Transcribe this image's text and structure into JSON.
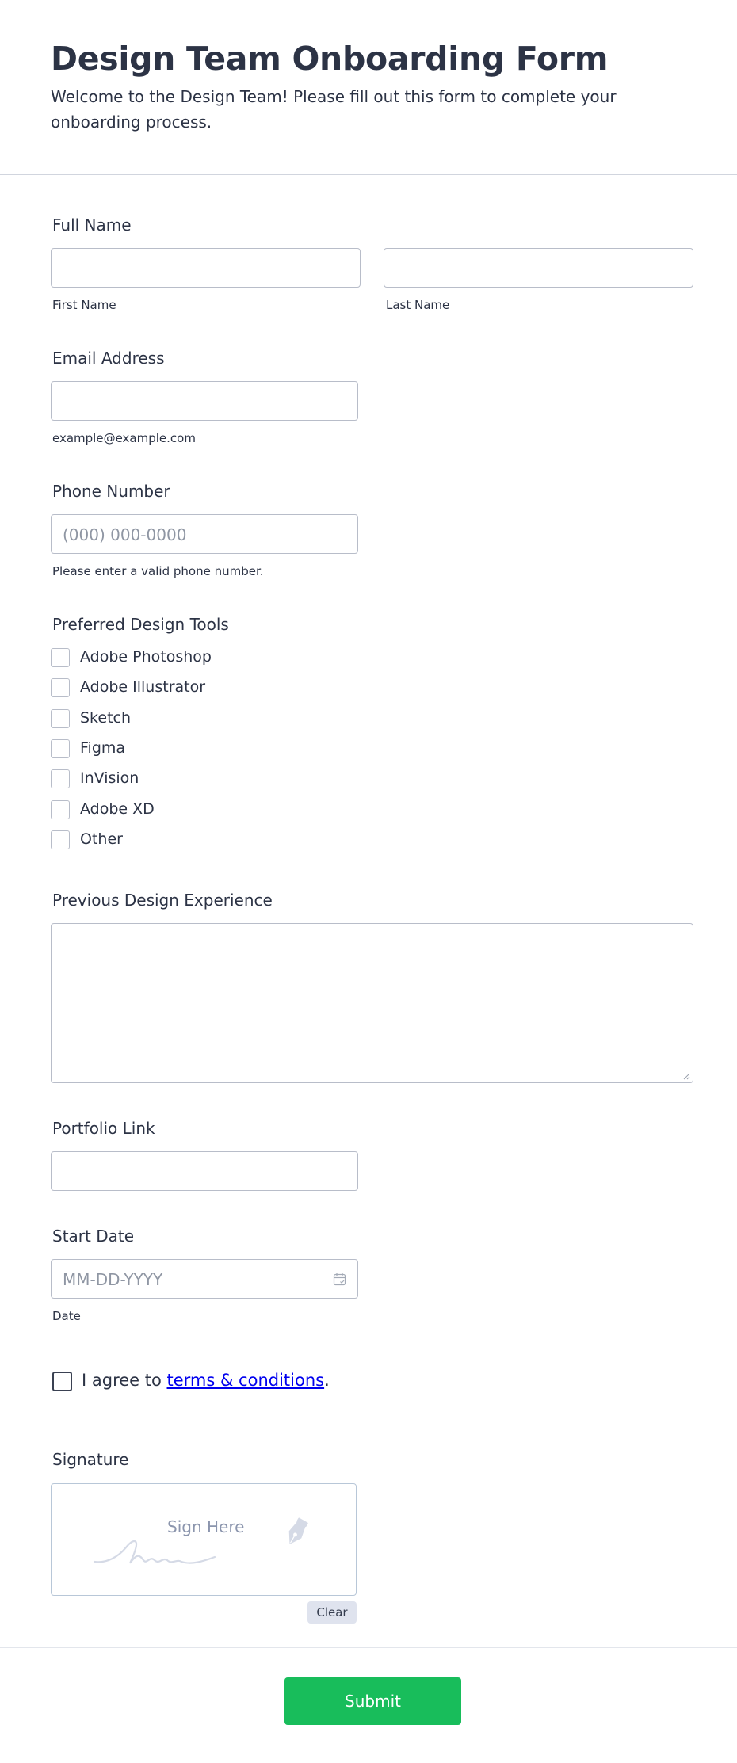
{
  "header": {
    "title": "Design Team Onboarding Form",
    "subtitle": "Welcome to the Design Team! Please fill out this form to complete your onboarding process."
  },
  "full_name": {
    "label": "Full Name",
    "first_sublabel": "First Name",
    "last_sublabel": "Last Name"
  },
  "email": {
    "label": "Email Address",
    "sublabel": "example@example.com"
  },
  "phone": {
    "label": "Phone Number",
    "placeholder": "(000) 000-0000",
    "sublabel": "Please enter a valid phone number."
  },
  "tools": {
    "label": "Preferred Design Tools",
    "options": [
      "Adobe Photoshop",
      "Adobe Illustrator",
      "Sketch",
      "Figma",
      "InVision",
      "Adobe XD",
      "Other"
    ]
  },
  "experience": {
    "label": "Previous Design Experience"
  },
  "portfolio": {
    "label": "Portfolio Link"
  },
  "start_date": {
    "label": "Start Date",
    "placeholder": "MM-DD-YYYY",
    "sublabel": "Date",
    "icon": "calendar-icon"
  },
  "terms": {
    "prefix": "I agree to ",
    "link_text": "terms & conditions",
    "suffix": "."
  },
  "signature": {
    "label": "Signature",
    "pad_text": "Sign Here",
    "clear_label": "Clear",
    "icon": "pen-nib-icon"
  },
  "submit": {
    "label": "Submit",
    "color": "#18bd5b"
  }
}
